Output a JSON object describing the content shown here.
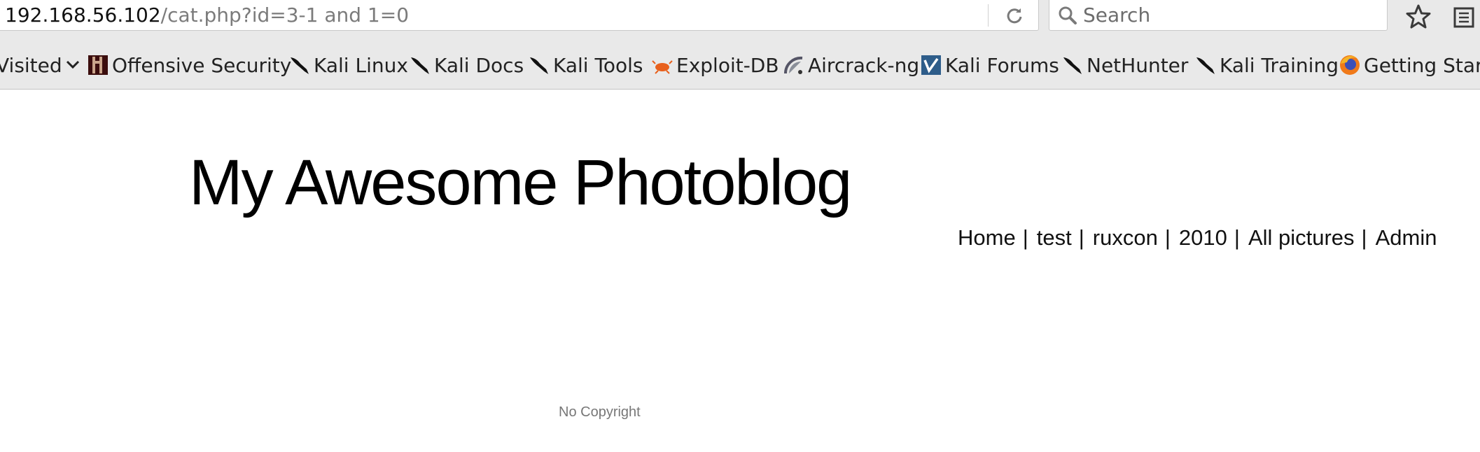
{
  "browser": {
    "url_host": "192.168.56.102",
    "url_path": "/cat.php?id=3-1 and 1=0",
    "search_placeholder": "Search"
  },
  "bookmarks": [
    {
      "label": "Visited",
      "icon": "chevron-down-icon"
    },
    {
      "label": "Offensive Security",
      "icon": "offsec-icon"
    },
    {
      "label": "Kali Linux",
      "icon": "kali-dragon-icon"
    },
    {
      "label": "Kali Docs",
      "icon": "kali-dragon-icon"
    },
    {
      "label": "Kali Tools",
      "icon": "kali-dragon-icon"
    },
    {
      "label": "Exploit-DB",
      "icon": "exploitdb-icon"
    },
    {
      "label": "Aircrack-ng",
      "icon": "aircrack-icon"
    },
    {
      "label": "Kali Forums",
      "icon": "kali-forums-icon"
    },
    {
      "label": "NetHunter",
      "icon": "kali-dragon-icon"
    },
    {
      "label": "Kali Training",
      "icon": "kali-dragon-icon"
    },
    {
      "label": "Getting Start",
      "icon": "firefox-icon"
    }
  ],
  "page": {
    "title": "My Awesome Photoblog",
    "nav": [
      "Home",
      "test",
      "ruxcon",
      "2010",
      "All pictures",
      "Admin"
    ],
    "nav_separator": "|",
    "footer": "No Copyright"
  }
}
